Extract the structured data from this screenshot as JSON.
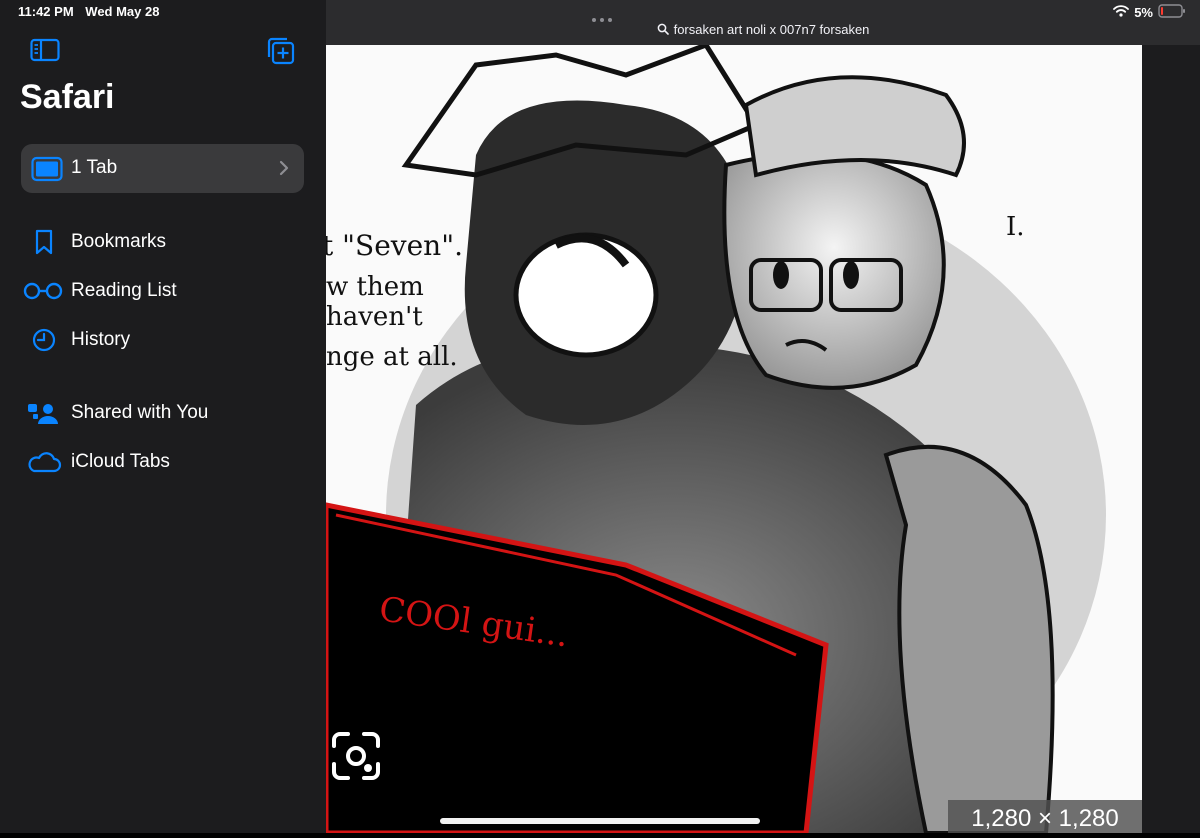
{
  "status": {
    "time": "11:42 PM",
    "date": "Wed May 28",
    "battery": "5%"
  },
  "sidebar": {
    "title": "Safari",
    "tab_group": {
      "label": "1 Tab"
    },
    "items": [
      {
        "label": "Bookmarks",
        "icon": "bookmark-icon"
      },
      {
        "label": "Reading List",
        "icon": "reading-list-icon"
      },
      {
        "label": "History",
        "icon": "history-icon"
      },
      {
        "label": "Shared with You",
        "icon": "shared-with-you-icon"
      },
      {
        "label": "iCloud Tabs",
        "icon": "icloud-icon"
      }
    ]
  },
  "content": {
    "search_query": "forsaken art noli x 007n7 forsaken",
    "image_dimensions": "1,280 × 1,280",
    "artwork_text": {
      "line1": "t \"Seven\".",
      "line2": "w them",
      "line3": "haven't",
      "line4": "nge at all.",
      "screen": "COOl gui...",
      "side": "I."
    }
  },
  "colors": {
    "accent": "#0a84ff",
    "sidebar_bg": "#1c1c1e",
    "selected_bg": "#3a3a3c",
    "art_red": "#d41414"
  }
}
